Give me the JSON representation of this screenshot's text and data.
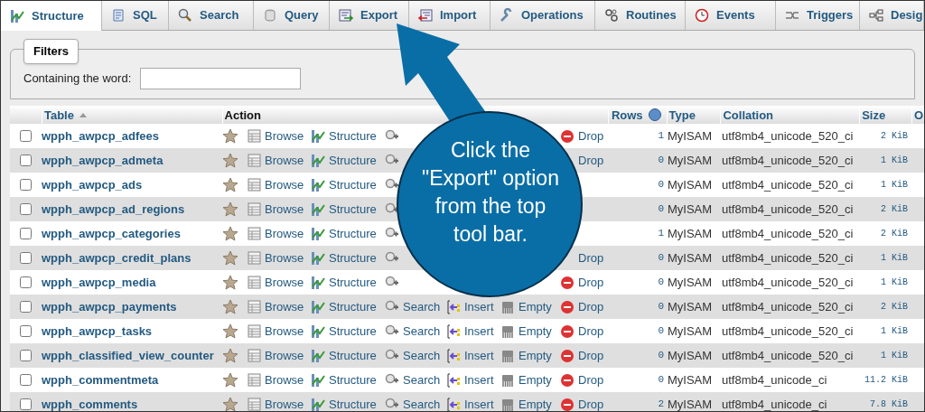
{
  "tabs": [
    {
      "label": "Structure",
      "selected": true
    },
    {
      "label": "SQL",
      "selected": false
    },
    {
      "label": "Search",
      "selected": false
    },
    {
      "label": "Query",
      "selected": false
    },
    {
      "label": "Export",
      "selected": false
    },
    {
      "label": "Import",
      "selected": false
    },
    {
      "label": "Operations",
      "selected": false
    },
    {
      "label": "Routines",
      "selected": false
    },
    {
      "label": "Events",
      "selected": false
    },
    {
      "label": "Triggers",
      "selected": false
    },
    {
      "label": "Desig",
      "selected": false
    }
  ],
  "filters": {
    "title": "Filters",
    "label": "Containing the word:"
  },
  "table": {
    "columns": [
      "Table",
      "Action",
      "Rows",
      "Type",
      "Collation",
      "Size",
      "O"
    ],
    "rows": [
      {
        "checked": false,
        "name": "wpph_awpcp_adfees",
        "actions": [
          {
            "kind": "browse",
            "label": "Browse"
          },
          {
            "kind": "structure",
            "label": "Structure"
          },
          {
            "kind": "search"
          },
          {
            "kind": "drop",
            "label": "Drop",
            "icon": true
          }
        ],
        "rows": "1",
        "type": "MyISAM",
        "collation": "utf8mb4_unicode_520_ci",
        "size": "2 KiB"
      },
      {
        "checked": false,
        "name": "wpph_awpcp_admeta",
        "actions": [
          {
            "kind": "browse",
            "label": "Browse"
          },
          {
            "kind": "structure",
            "label": "Structure"
          },
          {
            "kind": "search"
          },
          {
            "kind": "drop",
            "label": "Drop",
            "icon": false
          }
        ],
        "rows": "0",
        "type": "MyISAM",
        "collation": "utf8mb4_unicode_520_ci",
        "size": "1 KiB"
      },
      {
        "checked": false,
        "name": "wpph_awpcp_ads",
        "actions": [
          {
            "kind": "browse",
            "label": "Browse"
          },
          {
            "kind": "structure",
            "label": "Structure"
          },
          {
            "kind": "search"
          }
        ],
        "rows": "0",
        "type": "MyISAM",
        "collation": "utf8mb4_unicode_520_ci",
        "size": "1 KiB"
      },
      {
        "checked": false,
        "name": "wpph_awpcp_ad_regions",
        "actions": [
          {
            "kind": "browse",
            "label": "Browse"
          },
          {
            "kind": "structure",
            "label": "Structure"
          },
          {
            "kind": "search"
          }
        ],
        "rows": "0",
        "type": "MyISAM",
        "collation": "utf8mb4_unicode_520_ci",
        "size": "2 KiB"
      },
      {
        "checked": false,
        "name": "wpph_awpcp_categories",
        "actions": [
          {
            "kind": "browse",
            "label": "Browse"
          },
          {
            "kind": "structure",
            "label": "Structure"
          },
          {
            "kind": "search"
          }
        ],
        "rows": "1",
        "type": "MyISAM",
        "collation": "utf8mb4_unicode_520_ci",
        "size": "2 KiB"
      },
      {
        "checked": false,
        "name": "wpph_awpcp_credit_plans",
        "actions": [
          {
            "kind": "browse",
            "label": "Browse"
          },
          {
            "kind": "structure",
            "label": "Structure"
          },
          {
            "kind": "search"
          },
          {
            "kind": "drop",
            "label": "Drop",
            "icon": false
          }
        ],
        "rows": "0",
        "type": "MyISAM",
        "collation": "utf8mb4_unicode_520_ci",
        "size": "1 KiB"
      },
      {
        "checked": false,
        "name": "wpph_awpcp_media",
        "actions": [
          {
            "kind": "browse",
            "label": "Browse"
          },
          {
            "kind": "structure",
            "label": "Structure"
          },
          {
            "kind": "search"
          },
          {
            "kind": "drop",
            "label": "Drop",
            "icon": true
          }
        ],
        "rows": "0",
        "type": "MyISAM",
        "collation": "utf8mb4_unicode_520_ci",
        "size": "1 KiB"
      },
      {
        "checked": false,
        "name": "wpph_awpcp_payments",
        "actions": [
          {
            "kind": "browse",
            "label": "Browse"
          },
          {
            "kind": "structure",
            "label": "Structure"
          },
          {
            "kind": "search",
            "label": "Search"
          },
          {
            "kind": "insert",
            "label": "Insert"
          },
          {
            "kind": "empty",
            "label": "Empty"
          },
          {
            "kind": "drop",
            "label": "Drop",
            "icon": true
          }
        ],
        "rows": "0",
        "type": "MyISAM",
        "collation": "utf8mb4_unicode_520_ci",
        "size": "2 KiB"
      },
      {
        "checked": false,
        "name": "wpph_awpcp_tasks",
        "actions": [
          {
            "kind": "browse",
            "label": "Browse"
          },
          {
            "kind": "structure",
            "label": "Structure"
          },
          {
            "kind": "search",
            "label": "Search"
          },
          {
            "kind": "insert",
            "label": "Insert"
          },
          {
            "kind": "empty",
            "label": "Empty"
          },
          {
            "kind": "drop",
            "label": "Drop",
            "icon": true
          }
        ],
        "rows": "0",
        "type": "MyISAM",
        "collation": "utf8mb4_unicode_520_ci",
        "size": "1 KiB"
      },
      {
        "checked": false,
        "name": "wpph_classified_view_counter",
        "actions": [
          {
            "kind": "browse",
            "label": "Browse"
          },
          {
            "kind": "structure",
            "label": "Structure"
          },
          {
            "kind": "search",
            "label": "Search"
          },
          {
            "kind": "insert",
            "label": "Insert"
          },
          {
            "kind": "empty",
            "label": "Empty"
          },
          {
            "kind": "drop",
            "label": "Drop",
            "icon": true
          }
        ],
        "rows": "0",
        "type": "MyISAM",
        "collation": "utf8mb4_unicode_520_ci",
        "size": "1 KiB"
      },
      {
        "checked": false,
        "name": "wpph_commentmeta",
        "actions": [
          {
            "kind": "browse",
            "label": "Browse"
          },
          {
            "kind": "structure",
            "label": "Structure"
          },
          {
            "kind": "search",
            "label": "Search"
          },
          {
            "kind": "insert",
            "label": "Insert"
          },
          {
            "kind": "empty",
            "label": "Empty"
          },
          {
            "kind": "drop",
            "label": "Drop",
            "icon": true
          }
        ],
        "rows": "0",
        "type": "MyISAM",
        "collation": "utf8mb4_unicode_ci",
        "size": "11.2 KiB"
      },
      {
        "checked": false,
        "name": "wpph_comments",
        "actions": [
          {
            "kind": "browse",
            "label": "Browse"
          },
          {
            "kind": "structure",
            "label": "Structure"
          },
          {
            "kind": "search",
            "label": "Search"
          },
          {
            "kind": "insert",
            "label": "Insert"
          },
          {
            "kind": "empty",
            "label": "Empty"
          },
          {
            "kind": "drop",
            "label": "Drop",
            "icon": true
          }
        ],
        "rows": "2",
        "type": "MyISAM",
        "collation": "utf8mb4_unicode_ci",
        "size": "7.8 KiB"
      }
    ]
  },
  "callout": {
    "text": "Click the \"Export\" option from the top tool bar."
  }
}
